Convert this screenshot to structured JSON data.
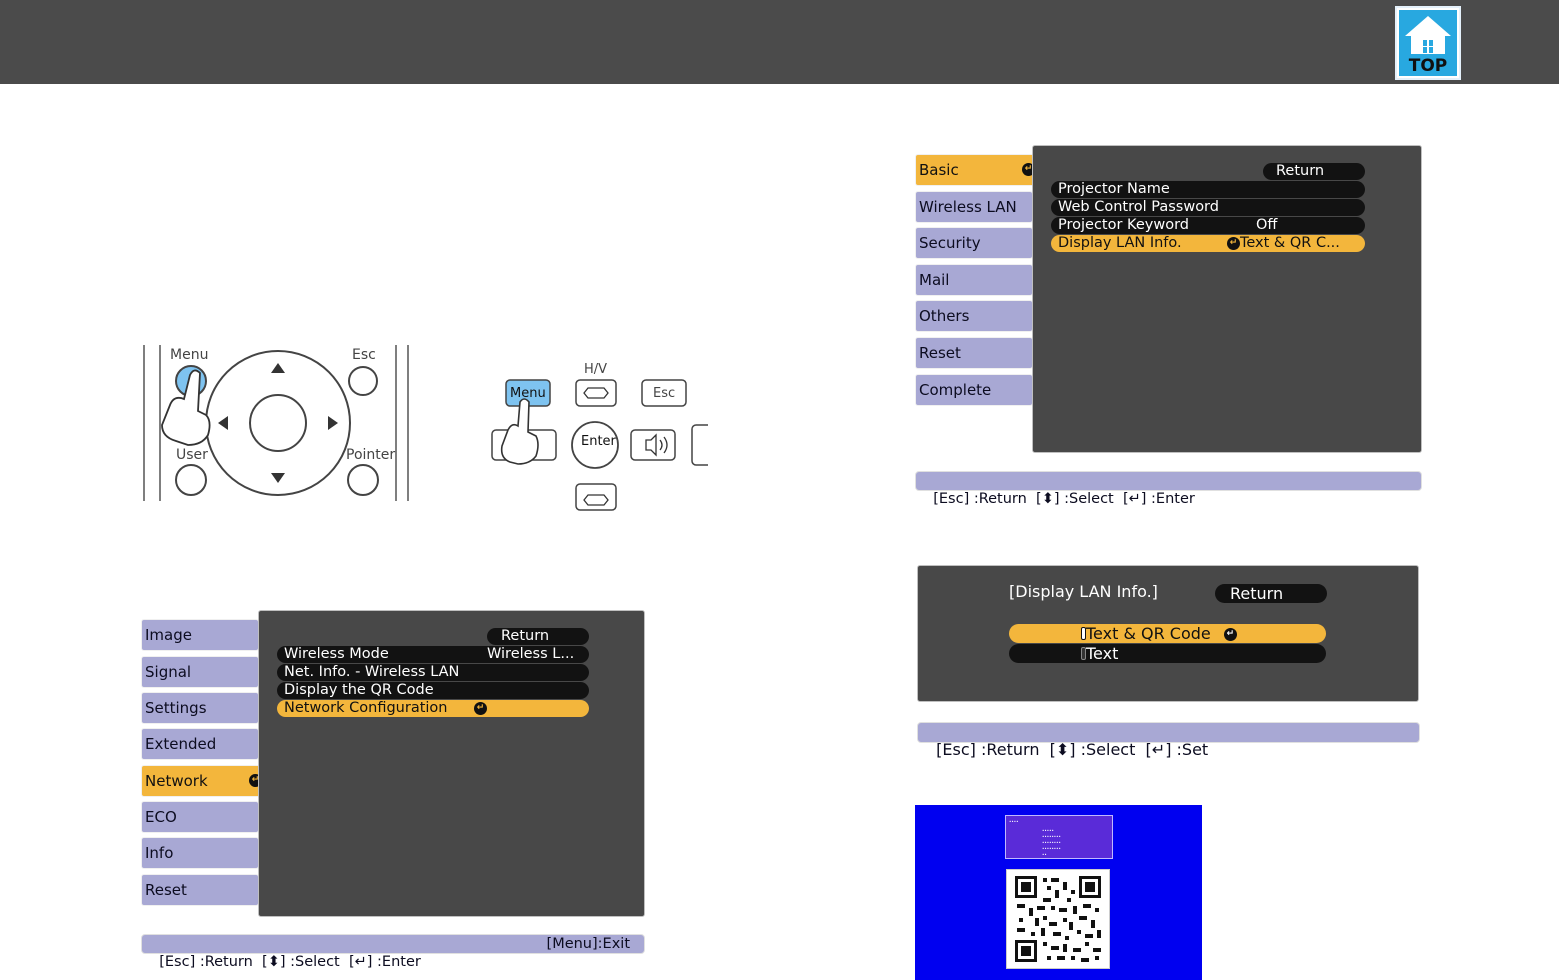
{
  "top_button": {
    "label": "TOP"
  },
  "remote_left": {
    "menu": "Menu",
    "esc": "Esc",
    "user": "User",
    "pointer": "Pointer"
  },
  "remote_right": {
    "hv": "H/V",
    "menu": "Menu",
    "esc": "Esc",
    "enter": "Enter"
  },
  "menu1": {
    "tabs": [
      "Image",
      "Signal",
      "Settings",
      "Extended",
      "Network",
      "ECO",
      "Info",
      "Reset"
    ],
    "active_tab": "Network",
    "return_label": "Return",
    "items": [
      {
        "label": "Wireless Mode",
        "value": "Wireless L..."
      },
      {
        "label": "Net. Info. - Wireless LAN",
        "value": ""
      },
      {
        "label": "Display the QR Code",
        "value": ""
      },
      {
        "label": "Network Configuration",
        "value": ""
      }
    ],
    "status_left": "[Esc] :Return  [⬍] :Select  [↵] :Enter",
    "status_right": "[Menu]:Exit"
  },
  "menu2": {
    "tabs": [
      "Basic",
      "Wireless LAN",
      "Security",
      "Mail",
      "Others",
      "Reset",
      "Complete"
    ],
    "active_tab": "Basic",
    "return_label": "Return",
    "items": [
      {
        "label": "Projector Name",
        "value": ""
      },
      {
        "label": "Web Control Password",
        "value": ""
      },
      {
        "label": "Projector Keyword",
        "value": "Off"
      },
      {
        "label": "Display LAN Info.",
        "value": "Text & QR C..."
      }
    ],
    "status_left": "[Esc] :Return  [⬍] :Select  [↵] :Enter"
  },
  "dialog": {
    "title": "[Display LAN Info.]",
    "return_label": "Return",
    "options": [
      "Text & QR Code",
      "Text"
    ],
    "status_left": "[Esc] :Return  [⬍] :Select  [↵] :Set"
  }
}
